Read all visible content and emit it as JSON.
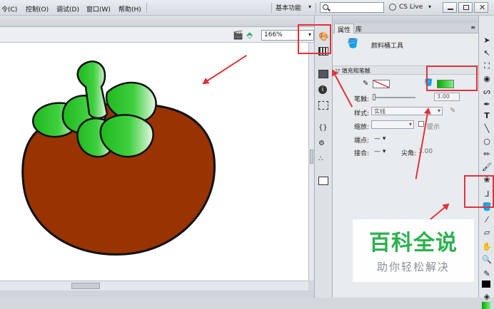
{
  "menubar": {
    "items": [
      "令(C)",
      "控制(O)",
      "调试(D)",
      "窗口(W)",
      "帮助(H)"
    ],
    "workspace": "基本功能",
    "search_placeholder": "",
    "cs_live": "CS Live"
  },
  "stage": {
    "zoom": "166%"
  },
  "panel": {
    "tabs": [
      "属性",
      "库"
    ],
    "tool_name": "颜料桶工具",
    "section_title": "填充和笔触",
    "stroke_label": "笔触:",
    "stroke_value": "3.00",
    "style_label": "样式:",
    "style_value": "实线",
    "scale_label": "缩放:",
    "hint_label": "提示",
    "cap_label": "端点:",
    "join_label": "接合:",
    "miter_label": "尖角:",
    "miter_value": "3.00"
  },
  "colors": {
    "accent_red": "#e0323c",
    "fruit_body": "#993300",
    "leaf_green": "#22c022",
    "watermark_green": "#2ab24d"
  },
  "watermark": {
    "title": "百科全说",
    "subtitle": "助你轻松解决"
  }
}
